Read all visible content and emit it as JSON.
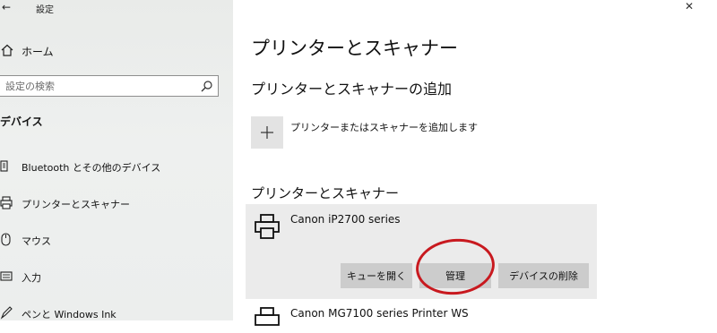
{
  "window": {
    "title": "設定",
    "back_icon": "back-arrow-icon",
    "close_icon": "close-icon"
  },
  "sidebar": {
    "home_label": "ホーム",
    "search_placeholder": "設定の検索",
    "section_heading": "デバイス",
    "items": [
      {
        "label": "Bluetooth とその他のデバイス",
        "icon": "bluetooth-device-icon"
      },
      {
        "label": "プリンターとスキャナー",
        "icon": "printer-icon"
      },
      {
        "label": "マウス",
        "icon": "mouse-icon"
      },
      {
        "label": "入力",
        "icon": "keyboard-icon"
      },
      {
        "label": "ペンと Windows Ink",
        "icon": "pen-icon"
      }
    ]
  },
  "main": {
    "page_title": "プリンターとスキャナー",
    "add_section_heading": "プリンターとスキャナーの追加",
    "add_device_label": "プリンターまたはスキャナーを追加します",
    "list_heading": "プリンターとスキャナー",
    "printers": [
      {
        "name": "Canon iP2700 series",
        "selected": true,
        "buttons": {
          "open_queue": "キューを開く",
          "manage": "管理",
          "remove": "デバイスの削除"
        }
      },
      {
        "name": "Canon MG7100 series Printer WS",
        "selected": false
      }
    ]
  },
  "colors": {
    "sidebar_bg": "#eceeed",
    "card_bg": "#ebebeb",
    "button_bg": "#cccccc",
    "annotation_red": "#c8191f"
  }
}
